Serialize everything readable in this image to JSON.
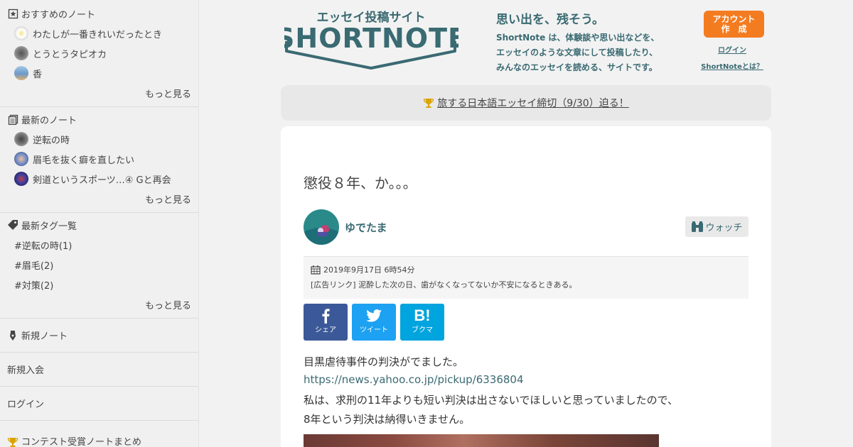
{
  "sidebar": {
    "recommended": {
      "heading": "おすすめのノート",
      "items": [
        "わたしが一番きれいだったとき",
        "とうとうタピオカ",
        "香"
      ],
      "more": "もっと見る"
    },
    "latest": {
      "heading": "最新のノート",
      "items": [
        "逆転の時",
        "眉毛を抜く癖を直したい",
        "剣道というスポーツ…④ Gと再会"
      ],
      "more": "もっと見る"
    },
    "tags": {
      "heading": "最新タグ一覧",
      "items": [
        "#逆転の時(1)",
        "#眉毛(2)",
        "#対策(2)"
      ],
      "more": "もっと見る"
    },
    "new_note": "新規ノート",
    "signup": "新規入会",
    "login": "ログイン",
    "contest": "コンテスト受賞ノートまとめ"
  },
  "header": {
    "logo_sub": "エッセイ投稿サイト",
    "logo_main": "SHORTNOTE",
    "tagline_title": "思い出を、残そう。",
    "tagline_lines": [
      "ShortNote は、体験談や思い出などを、",
      "エッセイのような文章にして投稿したり、",
      "みんなのエッセイを読める、サイトです。"
    ],
    "signup_line1": "アカウント",
    "signup_line2": "作　成",
    "login": "ログイン",
    "about": "ShortNoteとは？"
  },
  "banner": {
    "text": "旅する日本語エッセイ締切（9/30）迫る！"
  },
  "post": {
    "title": "懲役８年、か。。。",
    "author": "ゆでたま",
    "watch": "ウォッチ",
    "date": "2019年9月17日 6時54分",
    "ad": "[広告リンク] 泥酔した次の日、歯がなくなってないか不安になるときある。",
    "share": {
      "facebook": "シェア",
      "twitter": "ツイート",
      "hatena": "ブクマ",
      "hatena_glyph": "B!"
    },
    "body": [
      "目黒虐待事件の判決がでました。",
      "https://news.yahoo.co.jp/pickup/6336804",
      "私は、求刑の11年よりも短い判決は出さないでほしいと思っていましたので、",
      "8年という判決は納得いきません。"
    ]
  },
  "colors": {
    "brand": "#3a6a72",
    "accent": "#f47c20",
    "facebook": "#3b5998",
    "twitter": "#1da1f2",
    "hatena": "#00a4de",
    "trophy": "#d9a400"
  }
}
